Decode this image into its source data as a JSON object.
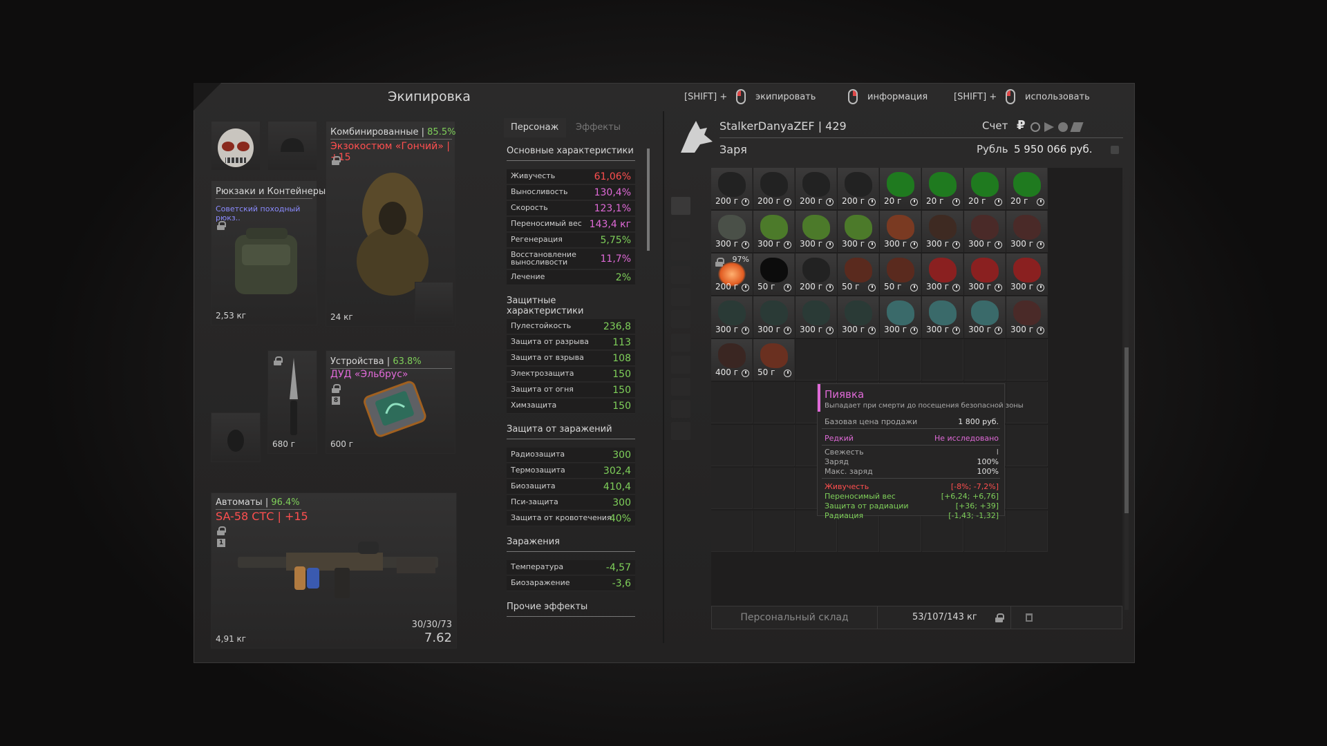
{
  "equipment": {
    "title": "Экипировка",
    "backpack": {
      "category": "Рюкзаки и Контейнеры",
      "name": "Советский походный рюкз..",
      "weight": "2,53 кг"
    },
    "armor": {
      "category": "Комбинированные",
      "percent": "85.5%",
      "name": "Экзокостюм «Гончий» | +15",
      "weight": "24 кг"
    },
    "knife": {
      "weight": "680 г"
    },
    "device": {
      "category": "Устройства",
      "percent": "63.8%",
      "name": "ДУД «Эльбрус»",
      "weight": "600 г",
      "slot_num": "8"
    },
    "weapon": {
      "category": "Автоматы",
      "percent": "96.4%",
      "name": "SA-58 СТС | +15",
      "weight": "4,91 кг",
      "ammo": "30/30/73",
      "caliber": "7.62",
      "slot_num": "1"
    }
  },
  "stats": {
    "tabs": [
      "Персонаж",
      "Эффекты"
    ],
    "sections": [
      {
        "title": "Основные характеристики",
        "rows": [
          {
            "k": "Живучесть",
            "v": "61,06%",
            "c": "red"
          },
          {
            "k": "Выносливость",
            "v": "130,4%",
            "c": "pink"
          },
          {
            "k": "Скорость",
            "v": "123,1%",
            "c": "pink"
          },
          {
            "k": "Переносимый вес",
            "v": "143,4 кг",
            "c": "pink"
          },
          {
            "k": "Регенерация",
            "v": "5,75%",
            "c": "green"
          },
          {
            "k": "Восстановление выносливости",
            "v": "11,7%",
            "c": "pink"
          },
          {
            "k": "Лечение",
            "v": "2%",
            "c": "green"
          }
        ]
      },
      {
        "title": "Защитные характеристики",
        "rows": [
          {
            "k": "Пулестойкость",
            "v": "236,8",
            "c": "green"
          },
          {
            "k": "Защита от разрыва",
            "v": "113",
            "c": "green"
          },
          {
            "k": "Защита от взрыва",
            "v": "108",
            "c": "green"
          },
          {
            "k": "Электрозащита",
            "v": "150",
            "c": "green"
          },
          {
            "k": "Защита от огня",
            "v": "150",
            "c": "green"
          },
          {
            "k": "Химзащита",
            "v": "150",
            "c": "green"
          }
        ]
      },
      {
        "title": "Защита от заражений",
        "rows": [
          {
            "k": "Радиозащита",
            "v": "300",
            "c": "green"
          },
          {
            "k": "Термозащита",
            "v": "302,4",
            "c": "green"
          },
          {
            "k": "Биозащита",
            "v": "410,4",
            "c": "green"
          },
          {
            "k": "Пси-защита",
            "v": "300",
            "c": "green"
          },
          {
            "k": "Защита от кровотечения",
            "v": "40%",
            "c": "green"
          }
        ]
      },
      {
        "title": "Заражения",
        "rows": [
          {
            "k": "Температура",
            "v": "-4,57",
            "c": "green"
          },
          {
            "k": "Биозаражение",
            "v": "-3,6",
            "c": "green"
          }
        ]
      },
      {
        "title": "Прочие эффекты",
        "rows": []
      }
    ]
  },
  "hints": {
    "shift1": "[SHIFT] +",
    "equip": "экипировать",
    "info": "информация",
    "shift2": "[SHIFT] +",
    "use": "использовать"
  },
  "player": {
    "name": "StalkerDanyaZEF | 429",
    "faction": "Заря",
    "account_label": "Счет",
    "currency": "Рубль",
    "money": "5 950 066 руб.",
    "currency_symbol": "₽"
  },
  "inventory": {
    "rows": [
      [
        {
          "p": "200 г",
          "c": "#222"
        },
        {
          "p": "200 г",
          "c": "#222"
        },
        {
          "p": "200 г",
          "c": "#222"
        },
        {
          "p": "200 г",
          "c": "#222"
        },
        {
          "p": "20 г",
          "c": "#1f7a1f"
        },
        {
          "p": "20 г",
          "c": "#1f7a1f"
        },
        {
          "p": "20 г",
          "c": "#1f7a1f"
        },
        {
          "p": "20 г",
          "c": "#1f7a1f"
        }
      ],
      [
        {
          "p": "300 г",
          "c": "#4a5048"
        },
        {
          "p": "300 г",
          "c": "#4c7a2a"
        },
        {
          "p": "300 г",
          "c": "#4c7a2a"
        },
        {
          "p": "300 г",
          "c": "#4c7a2a"
        },
        {
          "p": "300 г",
          "c": "#7a3a22"
        },
        {
          "p": "300 г",
          "c": "#3e2a22"
        },
        {
          "p": "300 г",
          "c": "#4a2a28"
        },
        {
          "p": "300 г",
          "c": "#4a2a28"
        }
      ],
      [
        {
          "p": "200 г",
          "c": "#e05a20",
          "pct": "97%"
        },
        {
          "p": "50 г",
          "c": "#0c0c0c"
        },
        {
          "p": "200 г",
          "c": "#222"
        },
        {
          "p": "50 г",
          "c": "#5a2a1e"
        },
        {
          "p": "50 г",
          "c": "#5a2a1e"
        },
        {
          "p": "300 г",
          "c": "#8a2020"
        },
        {
          "p": "300 г",
          "c": "#8a2020"
        },
        {
          "p": "300 г",
          "c": "#8a2020"
        }
      ],
      [
        {
          "p": "300 г",
          "c": "#2a3a36"
        },
        {
          "p": "300 г",
          "c": "#2a3a36"
        },
        {
          "p": "300 г",
          "c": "#2a3a36"
        },
        {
          "p": "300 г",
          "c": "#2a3a36"
        },
        {
          "p": "300 г",
          "c": "#3a6a6a"
        },
        {
          "p": "300 г",
          "c": "#3a6a6a"
        },
        {
          "p": "300 г",
          "c": "#3a6a6a"
        },
        {
          "p": "300 г",
          "c": "#4a2a28"
        }
      ],
      [
        {
          "p": "400 г",
          "c": "#3a2622"
        },
        {
          "p": "50 г",
          "c": "#6a3020"
        }
      ]
    ],
    "storage_label": "Персональный склад",
    "weight": "53/107/143 кг"
  },
  "tooltip": {
    "name": "Пиявка",
    "desc": "Выпадает при смерти до посещения безопасной зоны",
    "price_label": "Базовая цена продажи",
    "price": "1 800 руб.",
    "rarity": "Редкий",
    "research": "Не исследовано",
    "freshness_label": "Свежесть",
    "freshness": "I",
    "charge_label": "Заряд",
    "charge": "100%",
    "maxcharge_label": "Макс. заряд",
    "maxcharge": "100%",
    "effects": [
      {
        "k": "Живучесть",
        "v": "[-8%; -7,2%]",
        "c": "#ff4f4f"
      },
      {
        "k": "Переносимый вес",
        "v": "[+6,24; +6,76]",
        "c": "#7fd05a"
      },
      {
        "k": "Защита от радиации",
        "v": "[+36; +39]",
        "c": "#7fd05a"
      },
      {
        "k": "Радиация",
        "v": "[-1,43; -1,32]",
        "c": "#7fd05a"
      }
    ]
  }
}
